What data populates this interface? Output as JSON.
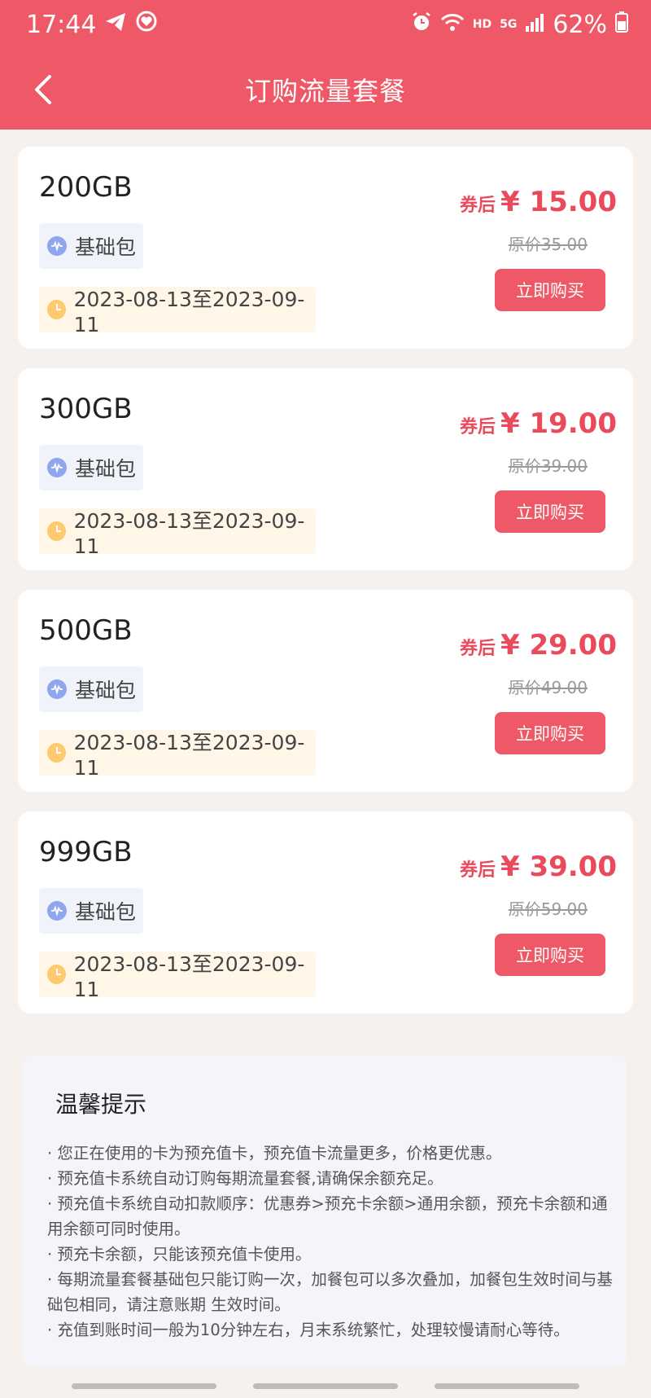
{
  "status_bar": {
    "time": "17:44",
    "network": "HD",
    "signal": "5G",
    "battery": "62%"
  },
  "header": {
    "title": "订购流量套餐"
  },
  "packages": [
    {
      "name": "200GB",
      "tag": "基础包",
      "period": "2023-08-13至2023-09-11",
      "price_prefix": "券后",
      "price": "¥ 15.00",
      "original": "原价35.00",
      "buy_label": "立即购买"
    },
    {
      "name": "300GB",
      "tag": "基础包",
      "period": "2023-08-13至2023-09-11",
      "price_prefix": "券后",
      "price": "¥ 19.00",
      "original": "原价39.00",
      "buy_label": "立即购买"
    },
    {
      "name": "500GB",
      "tag": "基础包",
      "period": "2023-08-13至2023-09-11",
      "price_prefix": "券后",
      "price": "¥ 29.00",
      "original": "原价49.00",
      "buy_label": "立即购买"
    },
    {
      "name": "999GB",
      "tag": "基础包",
      "period": "2023-08-13至2023-09-11",
      "price_prefix": "券后",
      "price": "¥ 39.00",
      "original": "原价59.00",
      "buy_label": "立即购买"
    }
  ],
  "tips": {
    "title": "温馨提示",
    "items": [
      "您正在使用的卡为预充值卡，预充值卡流量更多，价格更优惠。",
      "预充值卡系统自动订购每期流量套餐,请确保余额充足。",
      "预充值卡系统自动扣款顺序：优惠券>预充卡余额>通用余额，预充卡余额和通用余额可同时使用。",
      "预充卡余额，只能该预充值卡使用。",
      "每期流量套餐基础包只能订购一次，加餐包可以多次叠加，加餐包生效时间与基础包相同，请注意账期 生效时间。",
      "充值到账时间一般为10分钟左右，月末系统繁忙，处理较慢请耐心等待。"
    ]
  },
  "colors": {
    "brand": "#ef5866",
    "price": "#e94a5c",
    "background": "#f7f1ee"
  },
  "icons": {
    "back": "chevron-left-icon",
    "tag": "wave-icon",
    "date": "clock-icon"
  }
}
